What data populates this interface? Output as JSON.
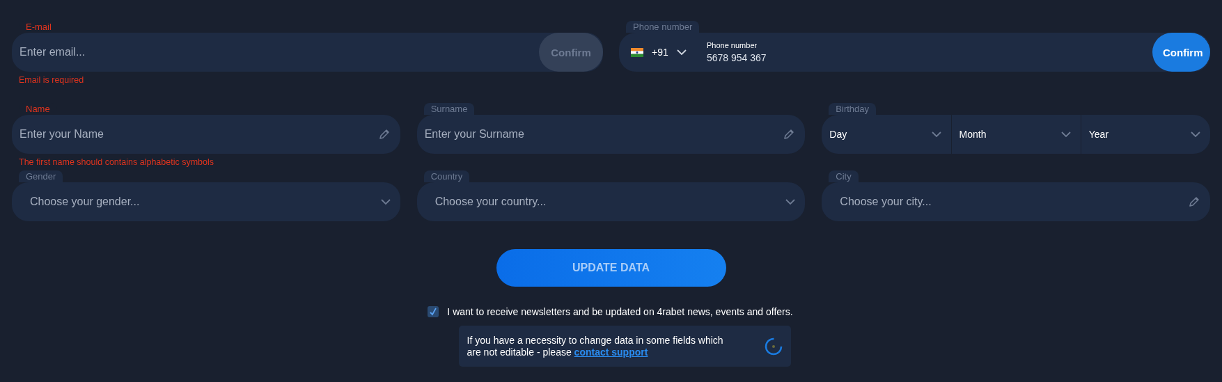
{
  "email": {
    "label": "E-mail",
    "invalid": true,
    "placeholder": "Enter email...",
    "confirm": {
      "label": "Confirm",
      "disabled": true
    },
    "error": "Email is required"
  },
  "phone": {
    "label": "Phone number",
    "invalid": false,
    "country_code": "+91",
    "inner_label": "Phone number",
    "value": "5678 954 367",
    "confirm": {
      "label": "Confirm",
      "disabled": false
    }
  },
  "rows": [
    [
      {
        "kind": "text",
        "label": "Name",
        "invalid": true,
        "placeholder": "Enter your Name",
        "error": "The first name should contains alphabetic symbols"
      },
      {
        "kind": "text",
        "label": "Surname",
        "invalid": false,
        "placeholder": "Enter your Surname"
      },
      {
        "kind": "date",
        "label": "Birthday",
        "invalid": false,
        "parts": [
          "Day",
          "Month",
          "Year"
        ]
      }
    ],
    [
      {
        "kind": "select",
        "label": "Gender",
        "invalid": false,
        "placeholder": "Choose your gender..."
      },
      {
        "kind": "select",
        "label": "Country",
        "invalid": false,
        "placeholder": "Choose your country..."
      },
      {
        "kind": "text",
        "label": "City",
        "invalid": false,
        "placeholder": "Choose your city..."
      }
    ]
  ],
  "update_button": {
    "label": "UPDATE DATA",
    "disabled": true
  },
  "newsletter": {
    "checked": true,
    "label": "I want to receive newsletters and be updated on 4rabet news, events and offers."
  },
  "notice": {
    "text": "If you have a necessity to change data in some fields which are not editable - please ",
    "link": "contact support"
  }
}
